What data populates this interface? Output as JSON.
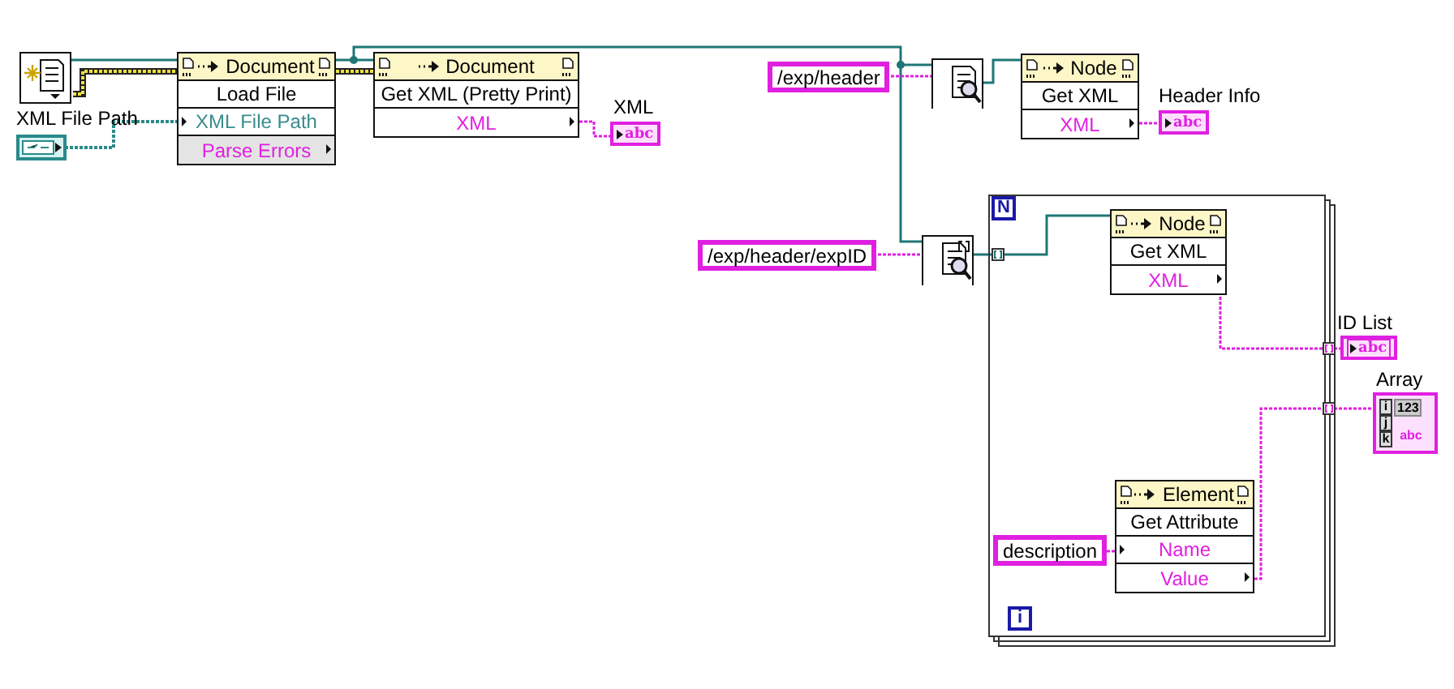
{
  "diagram": {
    "controls": [
      {
        "label": "XML File Path",
        "kind": "path"
      }
    ],
    "constants": [
      {
        "text": "/exp/header"
      },
      {
        "text": "/exp/header/expID"
      },
      {
        "text": "description"
      }
    ],
    "property_nodes": [
      {
        "class": "Document",
        "rows": [
          {
            "text": "Load File",
            "kind": "method",
            "color": "#000000",
            "unwired": false
          },
          {
            "text": "XML File Path",
            "kind": "input",
            "color": "#3a8c8c",
            "unwired": false
          },
          {
            "text": "Parse Errors",
            "kind": "output",
            "color": "#e020e0",
            "unwired": true
          }
        ]
      },
      {
        "class": "Document",
        "rows": [
          {
            "text": "Get XML (Pretty Print)",
            "kind": "method",
            "color": "#000000",
            "unwired": false
          },
          {
            "text": "XML",
            "kind": "output",
            "color": "#e020e0",
            "unwired": false
          }
        ]
      },
      {
        "class": "Node",
        "rows": [
          {
            "text": "Get XML",
            "kind": "method",
            "color": "#000000",
            "unwired": false
          },
          {
            "text": "XML",
            "kind": "output",
            "color": "#e020e0",
            "unwired": false
          }
        ]
      },
      {
        "class": "Node",
        "rows": [
          {
            "text": "Get XML",
            "kind": "method",
            "color": "#000000",
            "unwired": false
          },
          {
            "text": "XML",
            "kind": "output",
            "color": "#e020e0",
            "unwired": false
          }
        ]
      },
      {
        "class": "Element",
        "rows": [
          {
            "text": "Get Attribute",
            "kind": "method",
            "color": "#000000",
            "unwired": false
          },
          {
            "text": "Name",
            "kind": "input",
            "color": "#e020e0",
            "unwired": false
          },
          {
            "text": "Value",
            "kind": "output",
            "color": "#e020e0",
            "unwired": false
          }
        ]
      }
    ],
    "indicators": [
      {
        "label": "XML",
        "kind": "string",
        "glyph": "abc"
      },
      {
        "label": "Header Info",
        "kind": "string",
        "glyph": "abc"
      },
      {
        "label": "ID List",
        "kind": "string_array",
        "glyph": "abc"
      },
      {
        "label": "Array",
        "kind": "array_2d",
        "glyph": "123",
        "element_glyph": "abc",
        "index_labels": [
          "i",
          "j",
          "k"
        ]
      }
    ],
    "for_loop": {
      "count_terminal": "N",
      "iteration_terminal": "i"
    }
  }
}
